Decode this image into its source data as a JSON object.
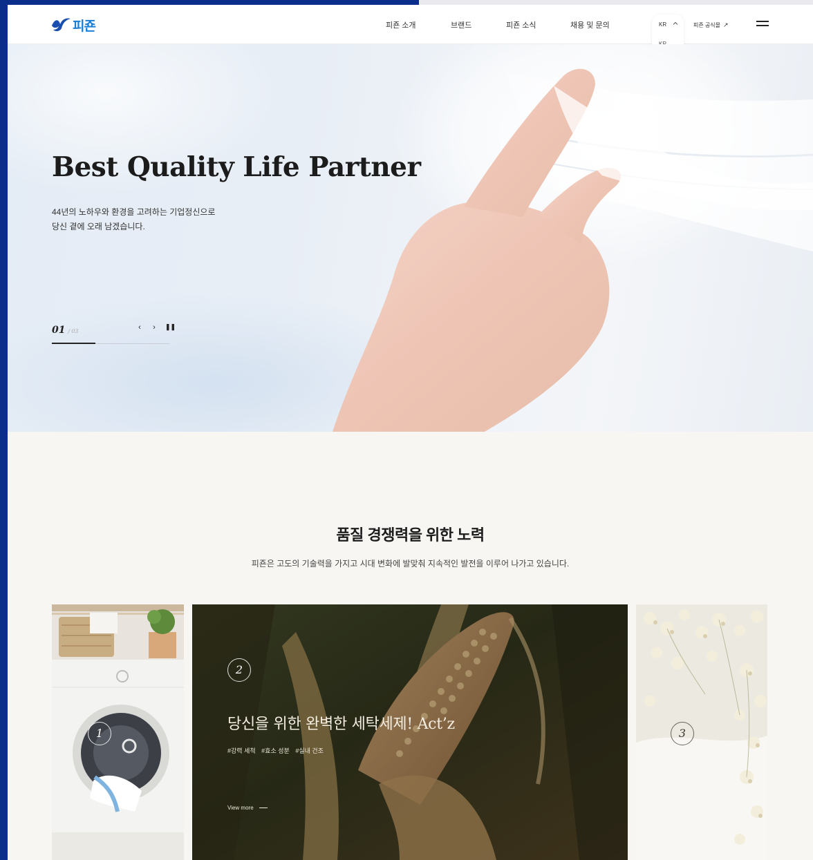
{
  "brand": {
    "logo_text": "피죤"
  },
  "nav": {
    "items": [
      {
        "label": "피죤 소개"
      },
      {
        "label": "브랜드"
      },
      {
        "label": "피죤 소식"
      },
      {
        "label": "채용 및 문의"
      }
    ]
  },
  "language": {
    "current": "KR",
    "options": [
      "KR",
      "EN"
    ]
  },
  "shop_link": {
    "label": "피죤 공식몰",
    "arrow": "↗"
  },
  "hero": {
    "title": "Best Quality Life Partner",
    "subtitle_lines": [
      "44년의 노하우와 환경을 고려하는 기업정신으로",
      "당신 곁에 오래 남겠습니다."
    ],
    "pager": {
      "current": "01",
      "separator": "/",
      "total": "03"
    },
    "controls": {
      "prev": "‹",
      "next": "›",
      "pause": "⏸"
    },
    "progress": 0.37
  },
  "section": {
    "title": "품질 경쟁력을 위한 노력",
    "subtitle": "피죤은 고도의 기술력을 가지고 시대 변화에 발맞춰 지속적인 발전을 이루어 나가고 있습니다."
  },
  "cards": [
    {
      "number": "1"
    },
    {
      "number": "2",
      "title": "당신을 위한 완벽한 세탁세제! Act’z",
      "tags": [
        "#강력 세척",
        "#효소 성분",
        "#실내 건조"
      ],
      "more": "View more"
    },
    {
      "number": "3"
    }
  ],
  "colors": {
    "brand_blue": "#0b2e8a",
    "logo_blue": "#1a7fd4",
    "background": "#f7f6f3"
  },
  "icons": {
    "menu": "hamburger-icon",
    "lang_toggle": "chevron-up-icon",
    "external": "arrow-up-right-icon"
  }
}
